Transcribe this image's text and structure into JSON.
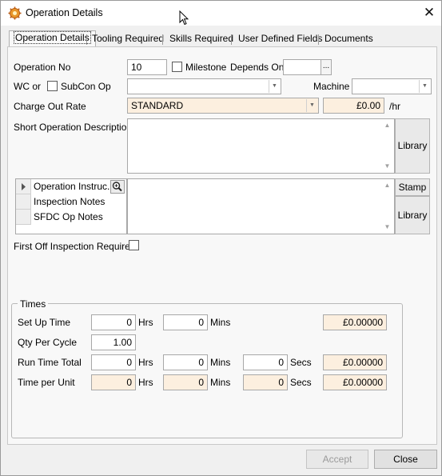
{
  "window": {
    "title": "Operation Details",
    "close_glyph": "✕"
  },
  "tabs": [
    {
      "label": "Operation Details"
    },
    {
      "label": "Tooling Required"
    },
    {
      "label": "Skills Required"
    },
    {
      "label": "User Defined Fields"
    },
    {
      "label": "Documents"
    }
  ],
  "operation": {
    "op_no_label": "Operation No",
    "op_no_value": "10",
    "milestone_label": "Milestone",
    "depends_on_label": "Depends On",
    "depends_on_value": "",
    "depends_btn": "...",
    "wc_label": "WC or",
    "subcon_label": "SubCon Op",
    "wc_value": "",
    "machine_label": "Machine",
    "machine_value": "",
    "charge_label": "Charge Out Rate",
    "charge_value": "STANDARD",
    "charge_amount": "£0.00",
    "charge_unit": "/hr",
    "short_desc_label": "Short Operation Description",
    "short_desc_value": "",
    "library_label": "Library",
    "stamp_label": "Stamp",
    "library2_label": "Library",
    "first_off_label": "First Off Inspection Required"
  },
  "notes_grid": {
    "rows": [
      {
        "label": "Operation Instruc..."
      },
      {
        "label": "Inspection Notes"
      },
      {
        "label": "SFDC Op Notes"
      }
    ],
    "notes_value": ""
  },
  "times": {
    "group_label": "Times",
    "setup": {
      "label": "Set Up Time",
      "hrs": "0",
      "mins": "0",
      "cost": "£0.00000"
    },
    "qty": {
      "label": "Qty Per Cycle",
      "value": "1.00"
    },
    "run": {
      "label": "Run Time Total",
      "hrs": "0",
      "mins": "0",
      "secs": "0",
      "cost": "£0.00000"
    },
    "unit": {
      "label": "Time per Unit",
      "hrs": "0",
      "mins": "0",
      "secs": "0",
      "cost": "£0.00000"
    },
    "hrs_label": "Hrs",
    "mins_label": "Mins",
    "secs_label": "Secs"
  },
  "footer": {
    "accept_label": "Accept",
    "close_label": "Close"
  },
  "colors": {
    "readonly_bg": "#fcefdf",
    "accent": "#d97a1c"
  }
}
